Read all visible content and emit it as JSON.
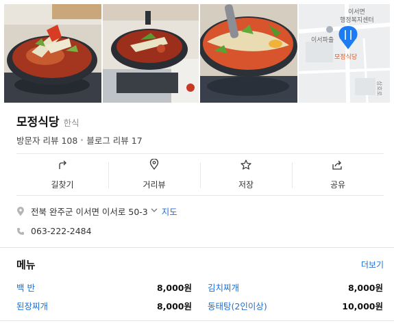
{
  "photos": [
    {
      "icon": "stew-photo-1"
    },
    {
      "icon": "stew-photo-2"
    },
    {
      "icon": "stew-photo-3"
    },
    {
      "icon": "map-thumbnail",
      "labels": [
        "이서면",
        "행정복지센터",
        "이서파출",
        "모정식당",
        "상호로"
      ]
    }
  ],
  "place": {
    "name": "모정식당",
    "category": "한식",
    "visitor_reviews": "방문자 리뷰 108",
    "blog_reviews": "블로그 리뷰 17"
  },
  "actions": [
    {
      "label": "길찾기",
      "icon": "directions-icon"
    },
    {
      "label": "거리뷰",
      "icon": "street-view-icon"
    },
    {
      "label": "저장",
      "icon": "star-icon"
    },
    {
      "label": "공유",
      "icon": "share-icon"
    }
  ],
  "address": {
    "text": "전북 완주군 이서면 이서로 50-3",
    "map_link": "지도"
  },
  "phone": "063-222-2484",
  "menu": {
    "title": "메뉴",
    "more": "더보기",
    "items": [
      {
        "name": "백 반",
        "price": "8,000원"
      },
      {
        "name": "김치찌개",
        "price": "8,000원"
      },
      {
        "name": "된장찌개",
        "price": "8,000원"
      },
      {
        "name": "동태탕(2인이상)",
        "price": "10,000원"
      }
    ]
  },
  "colors": {
    "accent": "#1a6fd6",
    "pin": "#1e7cf2"
  }
}
